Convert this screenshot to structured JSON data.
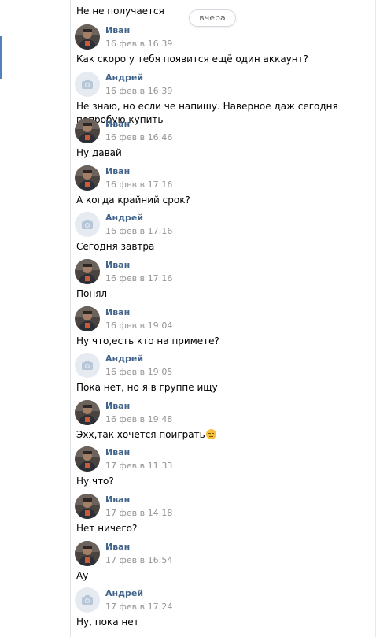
{
  "date_separator": "вчера",
  "previous_message": "Не не получается",
  "messages": [
    {
      "sender": "Иван",
      "avatar": "photo",
      "time": "16 фев в 16:39",
      "text": "Как скоро у тебя появится ещё один аккаунт?"
    },
    {
      "sender": "Андрей",
      "avatar": "default",
      "time": "16 фев в 16:39",
      "text": "Не знаю, но если че напишу. Наверное даж сегодня попробую купить"
    },
    {
      "sender": "Иван",
      "avatar": "photo",
      "time": "16 фев в 16:46",
      "text": "Ну давай"
    },
    {
      "sender": "Иван",
      "avatar": "photo",
      "time": "16 фев в 17:16",
      "text": "А когда крайний срок?"
    },
    {
      "sender": "Андрей",
      "avatar": "default",
      "time": "16 фев в 17:16",
      "text": "Сегодня завтра"
    },
    {
      "sender": "Иван",
      "avatar": "photo",
      "time": "16 фев в 17:16",
      "text": "Понял"
    },
    {
      "sender": "Иван",
      "avatar": "photo",
      "time": "16 фев в 19:04",
      "text": "Ну что,есть кто на примете?"
    },
    {
      "sender": "Андрей",
      "avatar": "default",
      "time": "16 фев в 19:05",
      "text": "Пока нет, но я в группе ищу"
    },
    {
      "sender": "Иван",
      "avatar": "photo",
      "time": "16 фев в 19:48",
      "text": "Эхх,так хочется поиграть",
      "emoji": "pensive-face"
    },
    {
      "sender": "Иван",
      "avatar": "photo",
      "time": "17 фев в 11:33",
      "text": "Ну что?"
    },
    {
      "sender": "Иван",
      "avatar": "photo",
      "time": "17 фев в 14:18",
      "text": "Нет ничего?"
    },
    {
      "sender": "Иван",
      "avatar": "photo",
      "time": "17 фев в 16:54",
      "text": "Ау"
    },
    {
      "sender": "Андрей",
      "avatar": "default",
      "time": "17 фев в 17:24",
      "text": "Ну, пока нет"
    }
  ],
  "colors": {
    "sender_name": "#42648b",
    "timestamp": "#939393",
    "default_avatar_bg": "#e5ebf1",
    "default_avatar_icon": "#b8c7d8",
    "gutter_indicator": "#5181b8"
  }
}
